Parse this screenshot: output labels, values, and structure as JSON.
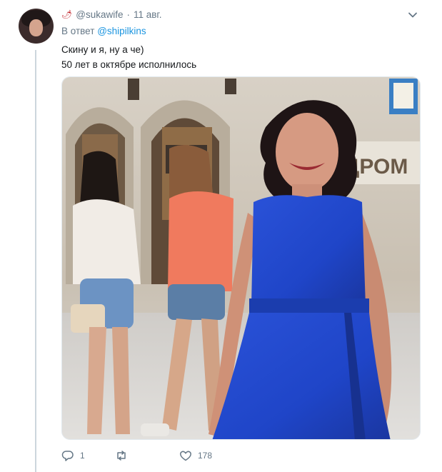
{
  "tweet": {
    "emoji": "🌶",
    "handle": "@sukawife",
    "separator": "·",
    "date": "11 авг.",
    "reply_prefix": "В ответ",
    "reply_mention": "@shipilkins",
    "text_line_1": "Скину и я, ну а че)",
    "text_line_2": "50 лет в октябре исполнилось",
    "photo_sign_text": "ДРОМ"
  },
  "actions": {
    "reply_count": "1",
    "retweet_count": "",
    "like_count": "178"
  },
  "icons": {
    "chevron": "chevron-down-icon",
    "reply": "reply-icon",
    "retweet": "retweet-icon",
    "like": "heart-icon"
  },
  "colors": {
    "link": "#1b95e0",
    "muted": "#657786",
    "thread_line": "#ccd6dd",
    "dress": "#1f45c8"
  }
}
